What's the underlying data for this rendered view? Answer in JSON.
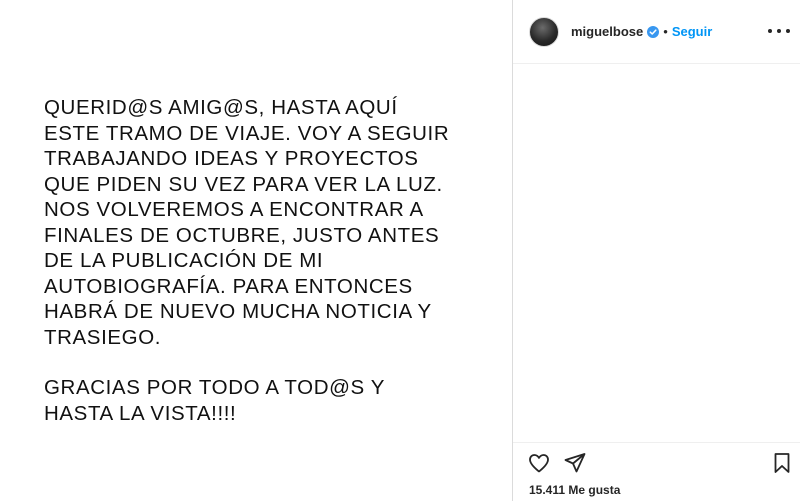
{
  "post": {
    "paragraphs": [
      "QUERID@S AMIG@S, HASTA AQUÍ\nESTE TRAMO DE VIAJE. VOY A SEGUIR\nTRABAJANDO IDEAS Y PROYECTOS\nQUE PIDEN SU VEZ PARA VER LA LUZ.\nNOS VOLVEREMOS A ENCONTRAR A\nFINALES DE OCTUBRE, JUSTO ANTES\nDE LA PUBLICACIÓN DE MI\nAUTOBIOGRAFÍA. PARA ENTONCES\nHABRÁ DE NUEVO MUCHA NOTICIA Y\nTRASIEGO.",
      "GRACIAS POR TODO A TOD@S Y\nHASTA LA VISTA!!!!"
    ]
  },
  "header": {
    "username": "miguelbose",
    "separator": "•",
    "follow_label": "Seguir"
  },
  "engagement": {
    "likes_text": "15.411 Me gusta"
  },
  "colors": {
    "accent": "#0095f6",
    "verified": "#3897f0",
    "text": "#262626"
  },
  "icons": {
    "like": "heart-icon",
    "share": "paper-plane-icon",
    "save": "bookmark-icon",
    "more": "more-options-icon",
    "verified": "verified-badge-icon"
  }
}
